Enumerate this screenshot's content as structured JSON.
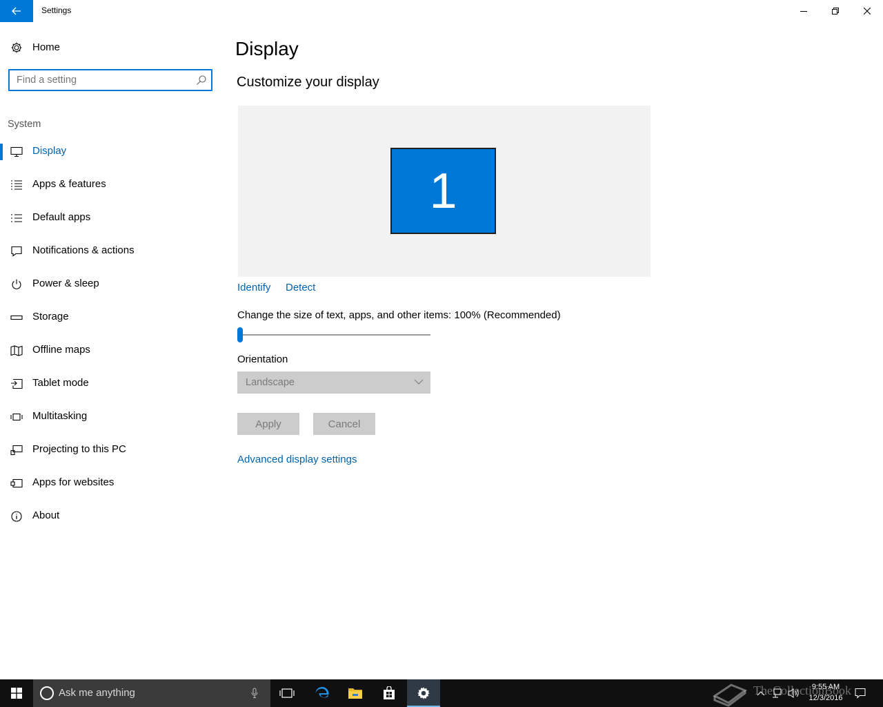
{
  "window": {
    "title": "Settings",
    "back_icon": "arrow-left-icon",
    "controls": [
      "minimize-icon",
      "restore-icon",
      "close-icon"
    ]
  },
  "sidebar": {
    "home_label": "Home",
    "search_placeholder": "Find a setting",
    "section_header": "System",
    "items": [
      {
        "label": "Display",
        "icon": "monitor-icon",
        "active": true
      },
      {
        "label": "Apps & features",
        "icon": "apps-list-icon"
      },
      {
        "label": "Default apps",
        "icon": "default-apps-icon"
      },
      {
        "label": "Notifications & actions",
        "icon": "notification-icon"
      },
      {
        "label": "Power & sleep",
        "icon": "power-icon"
      },
      {
        "label": "Storage",
        "icon": "storage-icon"
      },
      {
        "label": "Offline maps",
        "icon": "map-icon"
      },
      {
        "label": "Tablet mode",
        "icon": "tablet-mode-icon"
      },
      {
        "label": "Multitasking",
        "icon": "multitasking-icon"
      },
      {
        "label": "Projecting to this PC",
        "icon": "projecting-icon"
      },
      {
        "label": "Apps for websites",
        "icon": "apps-websites-icon"
      },
      {
        "label": "About",
        "icon": "info-icon"
      }
    ]
  },
  "main": {
    "title": "Display",
    "subtitle": "Customize your display",
    "monitor_number": "1",
    "identify_label": "Identify",
    "detect_label": "Detect",
    "scale_label": "Change the size of text, apps, and other items: 100% (Recommended)",
    "scale_slider_value": 0,
    "orientation_label": "Orientation",
    "orientation_value": "Landscape",
    "apply_label": "Apply",
    "cancel_label": "Cancel",
    "advanced_link": "Advanced display settings"
  },
  "taskbar": {
    "search_placeholder": "Ask me anything",
    "time": "9:55 AM",
    "date": "12/3/2016",
    "apps": [
      "task-view-icon",
      "edge-icon",
      "file-explorer-icon",
      "store-icon",
      "settings-gear-icon"
    ]
  },
  "watermark": "TheCollectionBook",
  "colors": {
    "accent": "#0078d7",
    "link": "#0063b1",
    "disabled_bg": "#cccccc",
    "preview_bg": "#f2f2f2",
    "taskbar": "#101010"
  }
}
